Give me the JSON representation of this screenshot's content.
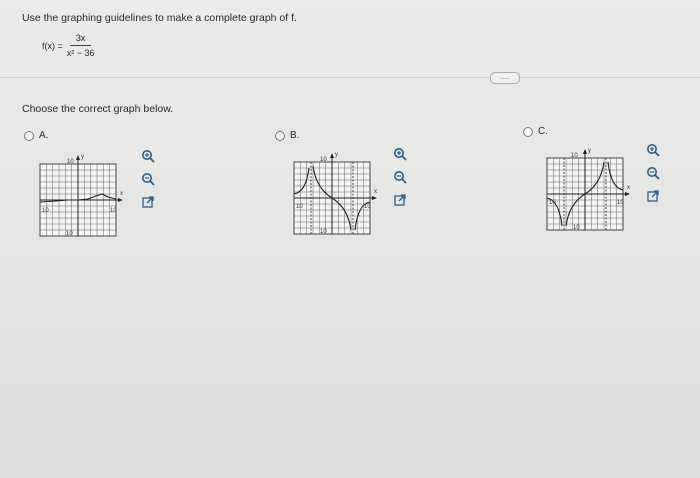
{
  "question": {
    "text": "Use the graphing guidelines to make a complete graph of f.",
    "func_lhs": "f(x) =",
    "func_num": "3x",
    "func_den": "x² − 36"
  },
  "more_button": "....",
  "prompt": "Choose the correct graph below.",
  "options": [
    {
      "label": "A.",
      "axis": {
        "y": "y",
        "x": "x",
        "ymax": "10",
        "ymin": "10",
        "xmin": "10",
        "xmax": "10"
      }
    },
    {
      "label": "B.",
      "axis": {
        "y": "y",
        "x": "x",
        "ymax": "10",
        "ymin": "10",
        "xmin": "10",
        "xmax": "10"
      }
    },
    {
      "label": "C.",
      "axis": {
        "y": "y",
        "x": "x",
        "ymax": "10",
        "ymin": "10",
        "xmin": "10",
        "xmax": "10"
      }
    }
  ],
  "icons": [
    "zoom-in-icon",
    "zoom-out-icon",
    "external-link-icon"
  ],
  "colors": {
    "tool_blue": "#2b5f8a",
    "grid": "#555555"
  }
}
